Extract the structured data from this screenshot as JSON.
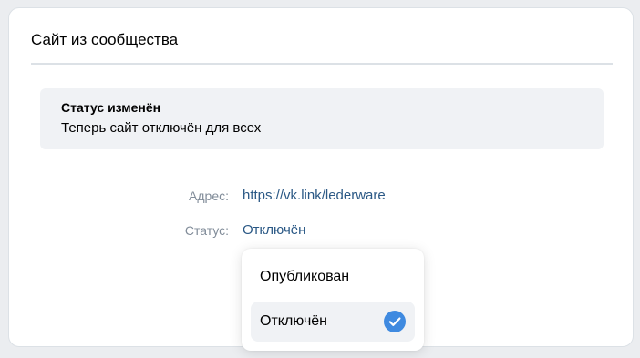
{
  "card": {
    "title": "Сайт из сообщества"
  },
  "notice": {
    "title": "Статус изменён",
    "text": "Теперь сайт отключён для всех"
  },
  "details": {
    "address_label": "Адрес:",
    "address_value": "https://vk.link/lederware",
    "status_label": "Статус:",
    "status_value": "Отключён"
  },
  "status_menu": {
    "options": [
      {
        "label": "Опубликован",
        "selected": false
      },
      {
        "label": "Отключён",
        "selected": true
      }
    ],
    "check_icon": "checkmark-circle-icon"
  },
  "colors": {
    "link": "#2a5885",
    "label": "#818c99",
    "notice_bg": "#f0f2f5",
    "accent": "#3f8ae0"
  }
}
